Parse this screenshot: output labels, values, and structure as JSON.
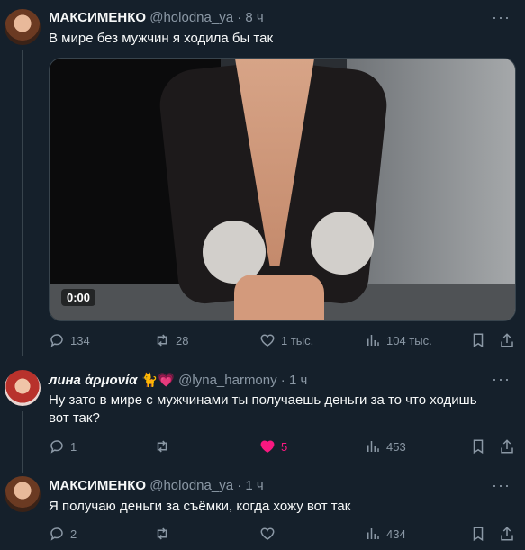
{
  "tweets": [
    {
      "name": "МАКСИМЕНКО",
      "handle": "@holodna_ya",
      "time": "· 8 ч",
      "text": "В мире без мужчин я ходила бы так",
      "video_time": "0:00",
      "replies": "134",
      "retweets": "28",
      "likes": "1 тыс.",
      "views": "104 тыс."
    },
    {
      "name": "лина ἁρμονία",
      "name_emoji": "🐈💗",
      "handle": "@lyna_harmony",
      "time": "· 1 ч",
      "text": "Ну зато в мире с мужчинами ты получаешь деньги за то что ходишь вот так?",
      "replies": "1",
      "retweets": "",
      "likes": "5",
      "views": "453"
    },
    {
      "name": "МАКСИМЕНКО",
      "handle": "@holodna_ya",
      "time": "· 1 ч",
      "text": "Я получаю деньги за съёмки, когда хожу вот так",
      "replies": "2",
      "retweets": "",
      "likes": "",
      "views": "434"
    }
  ],
  "more_label": "···",
  "colors": {
    "background": "#15202b",
    "muted": "#8b98a5",
    "like": "#f91880"
  },
  "icons": [
    "reply-icon",
    "retweet-icon",
    "like-icon",
    "views-icon",
    "bookmark-icon",
    "share-icon"
  ]
}
